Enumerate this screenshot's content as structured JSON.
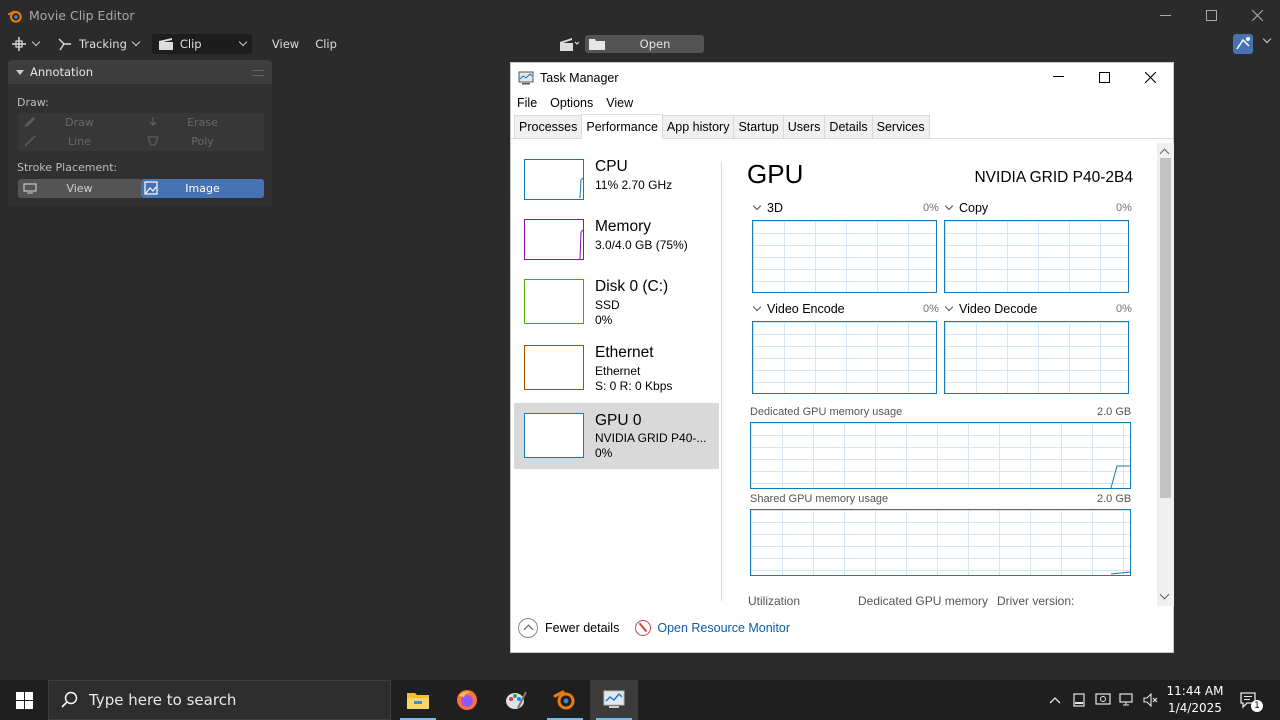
{
  "blender": {
    "window_title": "Movie Clip Editor",
    "header": {
      "mode_label": "Tracking",
      "view_label": "Clip",
      "menus": [
        "View",
        "Clip"
      ],
      "open_label": "Open"
    },
    "annotation": {
      "panel_title": "Annotation",
      "draw_label": "Draw:",
      "tools": [
        "Draw",
        "Erase",
        "Line",
        "Poly"
      ],
      "stroke_label": "Stroke Placement:",
      "placement": [
        "View",
        "Image"
      ],
      "placement_selected": "Image"
    },
    "colors": {
      "accent": "#4772b3",
      "bg": "#2b2b2b"
    }
  },
  "task_manager": {
    "title": "Task Manager",
    "menu": [
      "File",
      "Options",
      "View"
    ],
    "tabs": [
      "Processes",
      "Performance",
      "App history",
      "Startup",
      "Users",
      "Details",
      "Services"
    ],
    "active_tab": "Performance",
    "resources": [
      {
        "name": "CPU",
        "line1": "11%  2.70 GHz",
        "line2": "",
        "color": "#1779ba"
      },
      {
        "name": "Memory",
        "line1": "3.0/4.0 GB (75%)",
        "line2": "",
        "color": "#8b12ae"
      },
      {
        "name": "Disk 0 (C:)",
        "line1": "SSD",
        "line2": "0%",
        "color": "#4da60c"
      },
      {
        "name": "Ethernet",
        "line1": "Ethernet",
        "line2": "S: 0 R: 0 Kbps",
        "color": "#a74f01"
      },
      {
        "name": "GPU 0",
        "line1": "NVIDIA GRID P40-...",
        "line2": "0%",
        "color": "#1779ba"
      }
    ],
    "selected_resource": "GPU 0",
    "gpu": {
      "heading": "GPU",
      "model": "NVIDIA GRID P40-2B4",
      "engines": [
        {
          "label": "3D",
          "value": "0%"
        },
        {
          "label": "Copy",
          "value": "0%"
        },
        {
          "label": "Video Encode",
          "value": "0%"
        },
        {
          "label": "Video Decode",
          "value": "0%"
        }
      ],
      "dedicated_label": "Dedicated GPU memory usage",
      "dedicated_max": "2.0 GB",
      "shared_label": "Shared GPU memory usage",
      "shared_max": "2.0 GB",
      "stats": [
        "Utilization",
        "Dedicated GPU memory",
        "Driver version:"
      ]
    },
    "footer": {
      "fewer_details": "Fewer details",
      "resource_monitor": "Open Resource Monitor"
    }
  },
  "taskbar": {
    "search_placeholder": "Type here to search",
    "apps": [
      "file-explorer-icon",
      "firefox-icon",
      "paint-icon",
      "blender-icon",
      "task-manager-icon"
    ],
    "time": "11:44 AM",
    "date": "1/4/2025",
    "notification_count": "1"
  }
}
